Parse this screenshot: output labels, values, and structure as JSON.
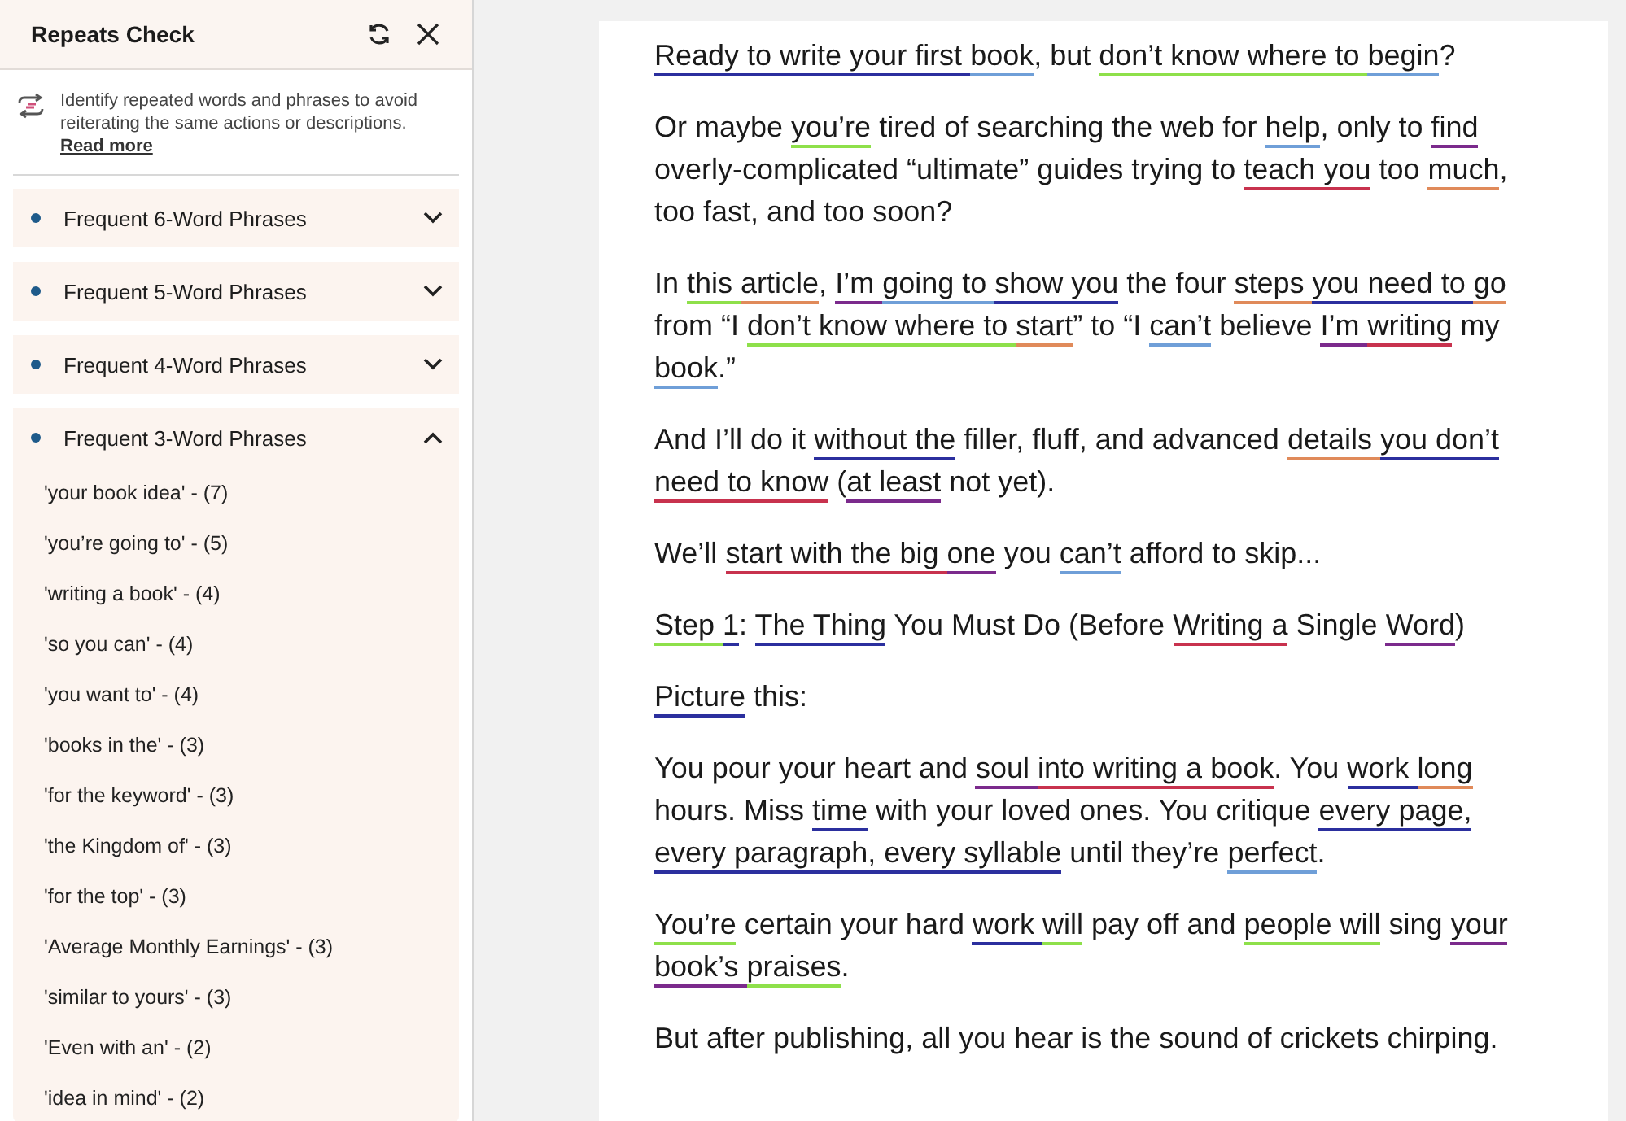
{
  "panel": {
    "title": "Repeats Check",
    "description": "Identify repeated words and phrases to avoid reiterating the same actions or descriptions.",
    "read_more": "Read more",
    "sections": [
      {
        "title": "Frequent 6-Word Phrases",
        "expanded": false
      },
      {
        "title": "Frequent 5-Word Phrases",
        "expanded": false
      },
      {
        "title": "Frequent 4-Word Phrases",
        "expanded": false
      },
      {
        "title": "Frequent 3-Word Phrases",
        "expanded": true,
        "items": [
          "'your book idea' - (7)",
          "'you’re going to' - (5)",
          "'writing a book' - (4)",
          "'so you can' - (4)",
          "'you want to' - (4)",
          "'books in the' - (3)",
          "'for the keyword' - (3)",
          "'the Kingdom of' - (3)",
          "'for the top' - (3)",
          "'Average Monthly Earnings' - (3)",
          "'similar to yours' - (3)",
          "'Even with an' - (2)",
          "'idea in mind' - (2)"
        ]
      }
    ]
  },
  "document": {
    "paragraphs": [
      [
        {
          "text": "Ready to write your first ",
          "color": "#2b2f9e"
        },
        {
          "text": "book",
          "color": "#6f9fd8"
        },
        {
          "text": ", but "
        },
        {
          "text": "don’t know where to ",
          "color": "#8ee04a"
        },
        {
          "text": "begin",
          "color": "#6f9fd8"
        },
        {
          "text": "?"
        }
      ],
      [
        {
          "text": "Or maybe "
        },
        {
          "text": "you’re",
          "color": "#8ee04a"
        },
        {
          "text": " tired of searching the web for "
        },
        {
          "text": "help",
          "color": "#6f9fd8"
        },
        {
          "text": ", only to "
        },
        {
          "text": "find",
          "color": "#7b2a8c"
        },
        {
          "text": " overly-complicated “ultimate” guides trying to "
        },
        {
          "text": "teach you",
          "color": "#c8324e"
        },
        {
          "text": " too "
        },
        {
          "text": "much",
          "color": "#e08a5a"
        },
        {
          "text": ", too fast, and too soon?"
        }
      ],
      [
        {
          "text": "In "
        },
        {
          "text": "this ",
          "color": "#8ee04a"
        },
        {
          "text": "article",
          "color": "#e08a5a"
        },
        {
          "text": ", "
        },
        {
          "text": "I’m ",
          "color": "#7b2a8c"
        },
        {
          "text": "going to ",
          "color": "#6f9fd8"
        },
        {
          "text": "show you",
          "color": "#2b2f9e"
        },
        {
          "text": " the four "
        },
        {
          "text": "steps ",
          "color": "#e08a5a"
        },
        {
          "text": "you need to ",
          "color": "#2b2f9e"
        },
        {
          "text": "go",
          "color": "#e08a5a"
        },
        {
          "text": " from “I "
        },
        {
          "text": "don’t know where to ",
          "color": "#8ee04a"
        },
        {
          "text": "start",
          "color": "#e08a5a"
        },
        {
          "text": "” to “I "
        },
        {
          "text": "can’t",
          "color": "#6f9fd8"
        },
        {
          "text": " believe "
        },
        {
          "text": "I’m ",
          "color": "#7b2a8c"
        },
        {
          "text": "writing",
          "color": "#c8324e"
        },
        {
          "text": " my "
        },
        {
          "text": "book",
          "color": "#6f9fd8"
        },
        {
          "text": ".”"
        }
      ],
      [
        {
          "text": "And I’ll do it "
        },
        {
          "text": "without the",
          "color": "#2b2f9e"
        },
        {
          "text": " filler, fluff, and advanced "
        },
        {
          "text": "details ",
          "color": "#e08a5a"
        },
        {
          "text": "you don’t ",
          "color": "#2b2f9e"
        },
        {
          "text": "need to know",
          "color": "#c8324e"
        },
        {
          "text": " ("
        },
        {
          "text": "at least",
          "color": "#7b2a8c"
        },
        {
          "text": " not yet)."
        }
      ],
      [
        {
          "text": "We’ll "
        },
        {
          "text": "start with the big ",
          "color": "#c8324e"
        },
        {
          "text": "one",
          "color": "#7b2a8c"
        },
        {
          "text": " you "
        },
        {
          "text": "can’t",
          "color": "#6f9fd8"
        },
        {
          "text": " afford to skip..."
        }
      ],
      [
        {
          "text": "Step ",
          "color": "#8ee04a"
        },
        {
          "text": "1",
          "color": "#2b2f9e"
        },
        {
          "text": ": "
        },
        {
          "text": "The Thing",
          "color": "#2b2f9e"
        },
        {
          "text": " You Must Do (Before "
        },
        {
          "text": "Writing a",
          "color": "#c8324e"
        },
        {
          "text": " Single "
        },
        {
          "text": "Word",
          "color": "#7b2a8c"
        },
        {
          "text": ")"
        }
      ],
      [
        {
          "text": "Picture",
          "color": "#2b2f9e"
        },
        {
          "text": " this:"
        }
      ],
      [
        {
          "text": "You pour your heart and "
        },
        {
          "text": "soul ",
          "color": "#7b2a8c"
        },
        {
          "text": "into writing a book",
          "color": "#c8324e"
        },
        {
          "text": ". You "
        },
        {
          "text": "work ",
          "color": "#2b2f9e"
        },
        {
          "text": "long",
          "color": "#e08a5a"
        },
        {
          "text": " hours. Miss "
        },
        {
          "text": "time",
          "color": "#2b2f9e"
        },
        {
          "text": " with your loved ones. You critique "
        },
        {
          "text": "every page, every paragraph, every syllable",
          "color": "#2b2f9e"
        },
        {
          "text": " until they’re "
        },
        {
          "text": "perfect",
          "color": "#6f9fd8"
        },
        {
          "text": "."
        }
      ],
      [
        {
          "text": "You’re",
          "color": "#8ee04a"
        },
        {
          "text": " certain your hard "
        },
        {
          "text": "work ",
          "color": "#2b2f9e"
        },
        {
          "text": "will",
          "color": "#8ee04a"
        },
        {
          "text": " pay off and "
        },
        {
          "text": "people ",
          "color": "#8ee04a"
        },
        {
          "text": "will",
          "color": "#8ee04a"
        },
        {
          "text": " sing "
        },
        {
          "text": "your book’s ",
          "color": "#7b2a8c"
        },
        {
          "text": "praises",
          "color": "#8ee04a"
        },
        {
          "text": "."
        }
      ],
      [
        {
          "text": "But after publishing, all you hear is the sound of crickets chirping."
        }
      ]
    ]
  }
}
